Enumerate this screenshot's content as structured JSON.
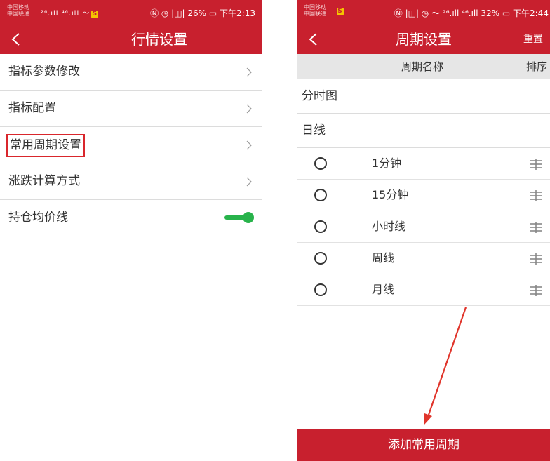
{
  "left_screen": {
    "status": {
      "carrier_1": "中国移动",
      "carrier_2": "中国联通",
      "signal": "²⁶.ıll ⁴⁶.ıll 〜",
      "right": "Ⓝ ◷ |◫| 26% ▭ 下午2:13"
    },
    "nav": {
      "title": "行情设置"
    },
    "menu": [
      {
        "label": "指标参数修改"
      },
      {
        "label": "指标配置"
      },
      {
        "label": "常用周期设置"
      },
      {
        "label": "涨跌计算方式"
      },
      {
        "label": "持仓均价线"
      }
    ],
    "toggle_state": "on"
  },
  "right_screen": {
    "status": {
      "carrier_1": "中国移动",
      "carrier_2": "中国联通",
      "right": "Ⓝ |◫| ◷ 〜 ²⁶.ıll ⁴⁶.ıll 32% ▭ 下午2:44"
    },
    "nav": {
      "title": "周期设置",
      "reset": "重置"
    },
    "columns": {
      "name": "周期名称",
      "sort": "排序"
    },
    "sections": [
      "分时图",
      "日线"
    ],
    "periods": [
      {
        "label": "1分钟"
      },
      {
        "label": "15分钟"
      },
      {
        "label": "小时线"
      },
      {
        "label": "周线"
      },
      {
        "label": "月线"
      }
    ],
    "add_button": "添加常用周期"
  },
  "colors": {
    "brand_red": "#c8202e",
    "toggle_green": "#28b34b",
    "annotation_red": "#d9262c"
  },
  "icons": [
    "back-icon",
    "chevron-right-icon",
    "radio-icon",
    "drag-handle-icon",
    "annotation-arrow"
  ]
}
